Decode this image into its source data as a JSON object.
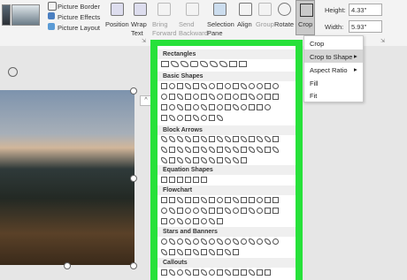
{
  "ribbon": {
    "picture_border": "Picture Border",
    "picture_effects": "Picture Effects",
    "picture_layout": "Picture Layout",
    "position": "Position",
    "wrap_text": "Wrap Text",
    "bring_forward": "Bring Forward",
    "send_backward": "Send Backward",
    "selection_pane": "Selection Pane",
    "align": "Align",
    "group": "Group",
    "rotate": "Rotate",
    "crop": "Crop",
    "height_label": "Height:",
    "height_value": "4.33\"",
    "width_label": "Width:",
    "width_value": "5.93\""
  },
  "crop_menu": {
    "items": [
      "Crop",
      "Crop to Shape",
      "Aspect Ratio",
      "Fill",
      "Fit"
    ]
  },
  "shapes_panel": {
    "categories": [
      "Rectangles",
      "Basic Shapes",
      "Block Arrows",
      "Equation Shapes",
      "Flowchart",
      "Stars and Banners",
      "Callouts"
    ]
  },
  "colors": {
    "highlight": "#27e13a",
    "crop_active": "#c9c9c9"
  },
  "icons": [
    "picture-border-icon",
    "picture-effects-icon",
    "picture-layout-icon",
    "position-icon",
    "wrap-text-icon",
    "bring-forward-icon",
    "send-backward-icon",
    "selection-pane-icon",
    "align-icon",
    "group-icon",
    "rotate-icon",
    "crop-icon",
    "rotate-handle-icon",
    "collapse-icon"
  ]
}
